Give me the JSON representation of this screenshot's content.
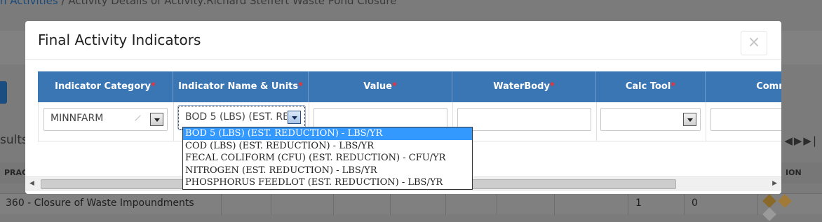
{
  "background": {
    "breadcrumb_link": "n Activities",
    "breadcrumb_sep": "/",
    "breadcrumb_current": "Activity Details of Activity:Richard Steffert Waste Pond Closure",
    "results_label": "sults",
    "table_header_left": "PRAC",
    "table_header_right": "ION",
    "row": {
      "practice": "360 - Closure of Waste Impoundments",
      "col_a": "1",
      "col_b": "0"
    }
  },
  "modal": {
    "title": "Final Activity Indicators",
    "close_label": "×",
    "columns": [
      {
        "label": "Indicator Category",
        "required": "*"
      },
      {
        "label": "Indicator Name & Units",
        "required": "*"
      },
      {
        "label": "Value",
        "required": "*"
      },
      {
        "label": "WaterBody",
        "required": "*"
      },
      {
        "label": "Calc Tool",
        "required": "*"
      },
      {
        "label": "Comm",
        "required": ""
      }
    ],
    "row": {
      "category_value": "MINNFARM",
      "indicator_value": "BOD 5 (LBS) (EST. REDUCTION) - LBS/YR",
      "value": "",
      "waterbody": "",
      "calc_tool": "",
      "comments": ""
    }
  },
  "dropdown": {
    "options": [
      "BOD 5 (LBS) (EST. REDUCTION) - LBS/YR",
      "COD (LBS) (EST. REDUCTION) - LBS/YR",
      "FECAL COLIFORM (CFU) (EST. REDUCTION) - CFU/YR",
      "NITROGEN (EST. REDUCTION) - LBS/YR",
      "PHOSPHORUS FEEDLOT (EST. REDUCTION) - LBS/YR"
    ],
    "selected_index": 0
  },
  "icons": {
    "close": "close-icon",
    "dropdown_arrow": "chevron-down-icon",
    "scroll_left": "arrow-left-icon",
    "scroll_right": "arrow-right-icon"
  }
}
